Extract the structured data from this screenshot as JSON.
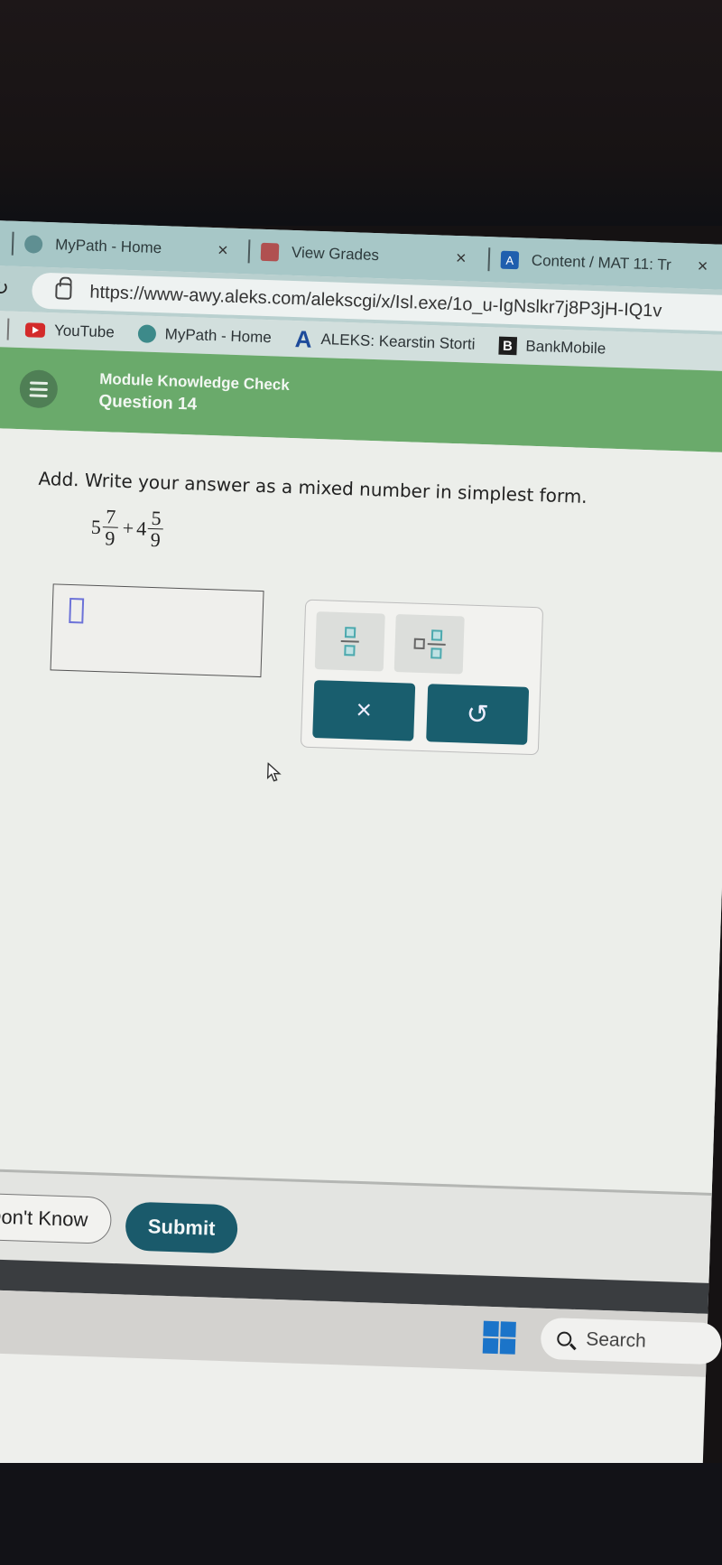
{
  "browser": {
    "tabs": [
      {
        "label": "MyPath - Home",
        "icon": "mypath-icon"
      },
      {
        "label": "View Grades",
        "icon": "grades-icon"
      },
      {
        "label": "Content / MAT 11: Tr",
        "icon": "aleks-icon"
      }
    ],
    "close_glyph": "×",
    "refresh_glyph": "↻",
    "url": "https://www-awy.aleks.com/alekscgi/x/Isl.exe/1o_u-IgNslkr7j8P3jH-IQ1v",
    "bookmarks": [
      {
        "label": "YouTube",
        "icon": "youtube-icon"
      },
      {
        "label": "MyPath - Home",
        "icon": "mypath-icon"
      },
      {
        "label": "ALEKS: Kearstin Storti",
        "icon": "aleks-icon",
        "glyph": "A"
      },
      {
        "label": "BankMobile",
        "icon": "bankmobile-icon",
        "glyph": "B"
      }
    ]
  },
  "header": {
    "title": "Module Knowledge Check",
    "subtitle": "Question 14"
  },
  "question": {
    "prompt": "Add. Write your answer as a mixed number in simplest form.",
    "terms": [
      {
        "whole": "5",
        "numerator": "7",
        "denominator": "9"
      },
      {
        "whole": "4",
        "numerator": "5",
        "denominator": "9"
      }
    ],
    "operator": "+"
  },
  "answer": {
    "value": ""
  },
  "keypad": {
    "clear_glyph": "×",
    "undo_glyph": "↺"
  },
  "footer": {
    "dont_know_label": "I Don't Know",
    "submit_label": "Submit"
  },
  "taskbar": {
    "search_label": "Search"
  }
}
